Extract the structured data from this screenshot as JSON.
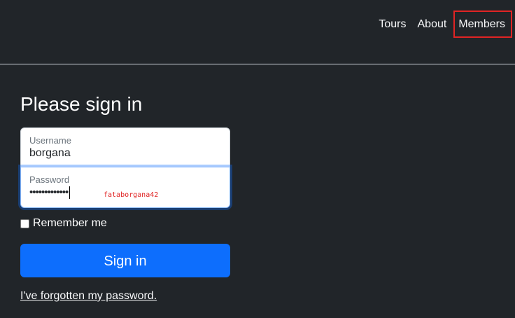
{
  "nav": {
    "links": [
      "Tours",
      "About",
      "Members"
    ],
    "highlighted": "Members"
  },
  "form": {
    "title": "Please sign in",
    "username_label": "Username",
    "username_value": "borgana",
    "password_label": "Password",
    "password_masked": "•••••••••••••",
    "password_hint": "fataborgana42",
    "remember_label": "Remember me",
    "submit_label": "Sign in",
    "forgot_label": "I've forgotten my password."
  },
  "colors": {
    "background": "#212529",
    "primary": "#0d6efd",
    "highlight_outline": "#e02424"
  }
}
